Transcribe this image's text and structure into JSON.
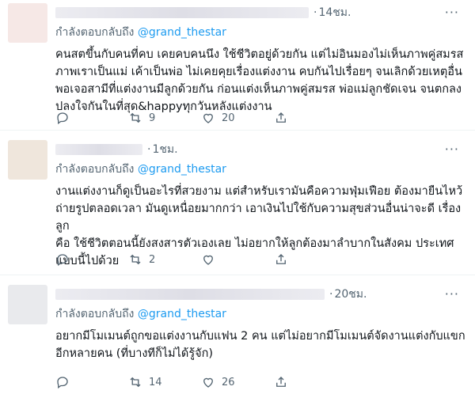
{
  "tweets": [
    {
      "time": "14ชม.",
      "more": "···",
      "replying_label": "กำลังตอบกลับถึง",
      "handle": "@grand_thestar",
      "text": "คนสตขึ้นกับคนที่คบ เคยคบคนนึง ใช้ชีวิตอยู่ด้วยกัน แต่ไม่อินมองไม่เห็นภาพคู่สมรส\nภาพเราเป็นแม่ เค้าเป็นพ่อ ไม่เคยคุยเรื่องแต่งงาน คบกันไปเรื่อยๆ จนเลิกด้วยเหตุอื่น\nพอเจอสามีที่แต่งงานมีลูกด้วยกัน ก่อนแต่งเห็นภาพคู่สมรส พ่อแม่ลูกชัดเจน จนตกลง\nปลงใจกันในที่สุด&happyทุกวันหลังแต่งงาน",
      "replies": "",
      "retweets": "9",
      "likes": "20"
    },
    {
      "time": "1ชม.",
      "more": "···",
      "replying_label": "กำลังตอบกลับถึง",
      "handle": "@grand_thestar",
      "text": "งานแต่งงานก็ดูเป็นอะไรที่สวยงาม แต่สำหรับเรามันคือความฟุ่มเฟือย ต้องมายืนไหว้\nถ่ายรูปตลอดเวลา มันดูเหนื่อยมากกว่า เอาเงินไปใช้กับความสุขส่วนอื่นน่าจะดี เรื่องลูก\nคือ ใช้ชีวิตตอนนี้ยังสงสารตัวเองเลย ไม่อยากให้ลูกต้องมาลำบากในสังคม ประเทศ\nแบบนี้ไปด้วย",
      "replies": "",
      "retweets": "2",
      "likes": ""
    },
    {
      "time": "20ชม.",
      "more": "···",
      "replying_label": "กำลังตอบกลับถึง",
      "handle": "@grand_thestar",
      "text": "อยากมีโมเมนต์ถูกขอแต่งงานกับแฟน 2 คน แต่ไม่อยากมีโมเมนต์จัดงานแต่งกับแขก\nอีกหลายคน (ที่บางทีก็ไม่ได้รู้จัก)",
      "replies": "",
      "retweets": "14",
      "likes": "26"
    }
  ]
}
